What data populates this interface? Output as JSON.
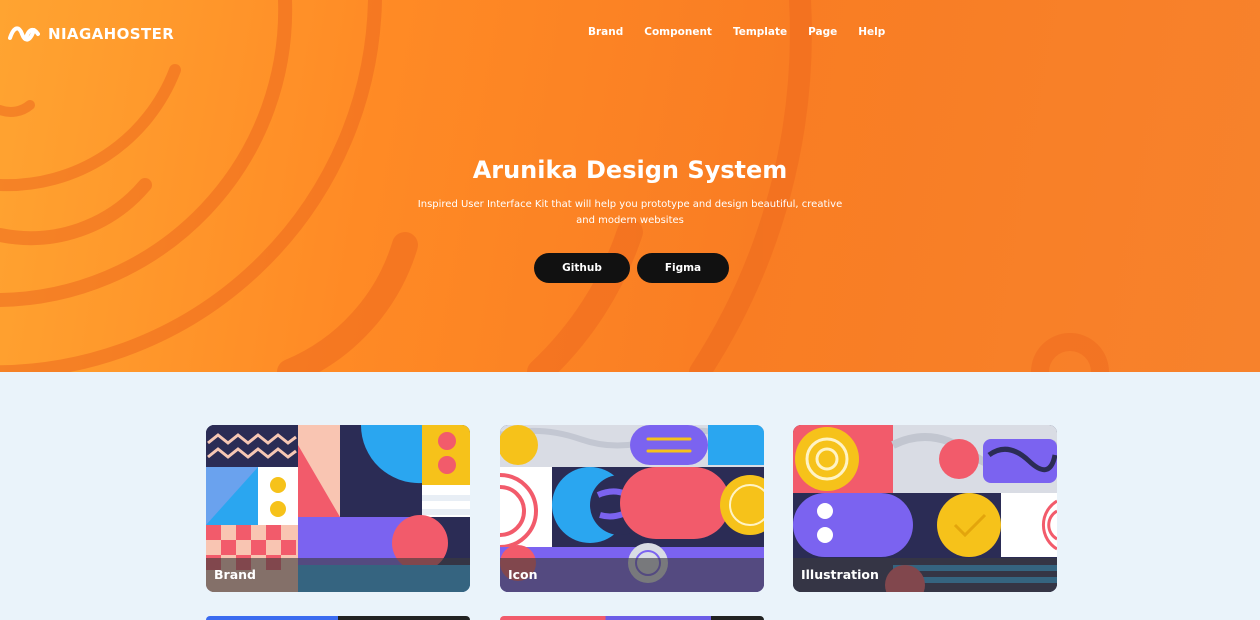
{
  "brand": {
    "name": "NIAGAHOSTER",
    "logo_icon": "niagahoster-logo-icon"
  },
  "nav": {
    "items": [
      {
        "label": "Brand"
      },
      {
        "label": "Component"
      },
      {
        "label": "Template"
      },
      {
        "label": "Page"
      },
      {
        "label": "Help"
      }
    ]
  },
  "hero": {
    "title": "Arunika Design System",
    "subtitle": "Inspired User Interface Kit that will help you prototype and design beautiful, creative and modern websites",
    "buttons": [
      {
        "label": "Github"
      },
      {
        "label": "Figma"
      }
    ]
  },
  "cards": [
    {
      "label": "Brand"
    },
    {
      "label": "Icon"
    },
    {
      "label": "Illustration"
    }
  ],
  "colors": {
    "hero_orange": "#fa8a28",
    "button_dark": "#111111",
    "page_background": "#eaf3fa",
    "accent_red": "#f25b6b",
    "accent_blue": "#2aa6f0",
    "accent_yellow": "#f6c21a",
    "accent_purple": "#7b63f0",
    "accent_navy": "#2b2c55"
  }
}
